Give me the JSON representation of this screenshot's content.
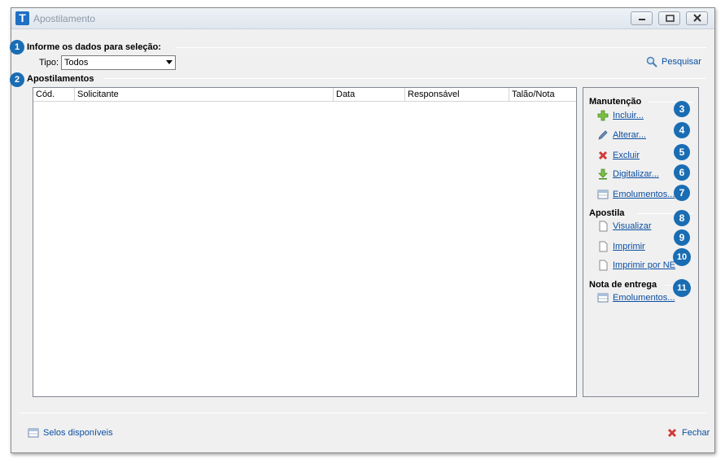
{
  "window": {
    "title": "Apostilamento",
    "app_icon_letter": "T",
    "controls": [
      "minimize",
      "maximize",
      "close"
    ]
  },
  "badges": [
    "1",
    "2",
    "3",
    "4",
    "5",
    "6",
    "7",
    "8",
    "9",
    "10",
    "11"
  ],
  "filter": {
    "section_title": "Informe os dados para seleção:",
    "tipo_label": "Tipo:",
    "tipo_value": "Todos",
    "search_label": "Pesquisar",
    "search_icon": "magnifier-icon"
  },
  "list": {
    "section_title": "Apostilamentos",
    "columns": [
      "Cód.",
      "Solicitante",
      "Data",
      "Responsável",
      "Talão/Nota"
    ],
    "rows": []
  },
  "side": {
    "manutencao": {
      "title": "Manutenção",
      "items": [
        {
          "label": "Incluir...",
          "icon": "plus-icon"
        },
        {
          "label": "Alterar...",
          "icon": "pencil-icon"
        },
        {
          "label": "Excluir",
          "icon": "delete-x-icon"
        },
        {
          "label": "Digitalizar...",
          "icon": "scan-download-icon"
        },
        {
          "label": "Emolumentos...",
          "icon": "table-icon"
        }
      ]
    },
    "apostila": {
      "title": "Apostila",
      "items": [
        {
          "label": "Visualizar",
          "icon": "document-icon"
        },
        {
          "label": "Imprimir",
          "icon": "document-icon"
        },
        {
          "label": "Imprimir por NE",
          "icon": "document-icon"
        }
      ]
    },
    "nota": {
      "title": "Nota de entrega",
      "items": [
        {
          "label": "Emolumentos...",
          "icon": "table-icon"
        }
      ]
    }
  },
  "footer": {
    "selos_label": "Selos disponíveis",
    "fechar_label": "Fechar"
  },
  "colors": {
    "badge": "#1a6db3",
    "link": "#0b4ea2",
    "window_bg": "#f0f0f0",
    "green_icon": "#5aa02c",
    "red_icon": "#d23a3a"
  }
}
